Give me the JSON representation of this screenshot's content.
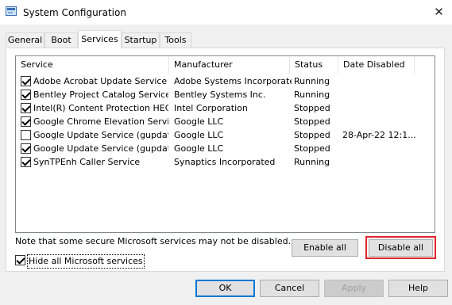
{
  "window": {
    "title": "System Configuration",
    "close_glyph": "✕"
  },
  "tabs": [
    {
      "label": "General",
      "active": false
    },
    {
      "label": "Boot",
      "active": false
    },
    {
      "label": "Services",
      "active": true
    },
    {
      "label": "Startup",
      "active": false
    },
    {
      "label": "Tools",
      "active": false
    }
  ],
  "services": {
    "columns": [
      "Service",
      "Manufacturer",
      "Status",
      "Date Disabled"
    ],
    "rows": [
      {
        "checked": true,
        "service": "Adobe Acrobat Update Service",
        "manufacturer": "Adobe Systems Incorporated",
        "status": "Running",
        "date_disabled": ""
      },
      {
        "checked": true,
        "service": "Bentley Project Catalog Service",
        "manufacturer": "Bentley Systems Inc.",
        "status": "Running",
        "date_disabled": ""
      },
      {
        "checked": true,
        "service": "Intel(R) Content Protection HEC...",
        "manufacturer": "Intel Corporation",
        "status": "Stopped",
        "date_disabled": ""
      },
      {
        "checked": true,
        "service": "Google Chrome Elevation Servic...",
        "manufacturer": "Google LLC",
        "status": "Stopped",
        "date_disabled": ""
      },
      {
        "checked": false,
        "service": "Google Update Service (gupdate)",
        "manufacturer": "Google LLC",
        "status": "Stopped",
        "date_disabled": "28-Apr-22 12:1..."
      },
      {
        "checked": true,
        "service": "Google Update Service (gupdatem)",
        "manufacturer": "Google LLC",
        "status": "Stopped",
        "date_disabled": ""
      },
      {
        "checked": true,
        "service": "SynTPEnh Caller Service",
        "manufacturer": "Synaptics Incorporated",
        "status": "Running",
        "date_disabled": ""
      }
    ]
  },
  "note": "Note that some secure Microsoft services may not be disabled.",
  "buttons": {
    "enable_all": "Enable all",
    "disable_all": "Disable all",
    "ok": "OK",
    "cancel": "Cancel",
    "apply": "Apply",
    "help": "Help"
  },
  "hide_microsoft": {
    "label": "Hide all Microsoft services",
    "checked": true
  },
  "colors": {
    "highlight": "#e0262b",
    "default_button_border": "#0078d7"
  }
}
